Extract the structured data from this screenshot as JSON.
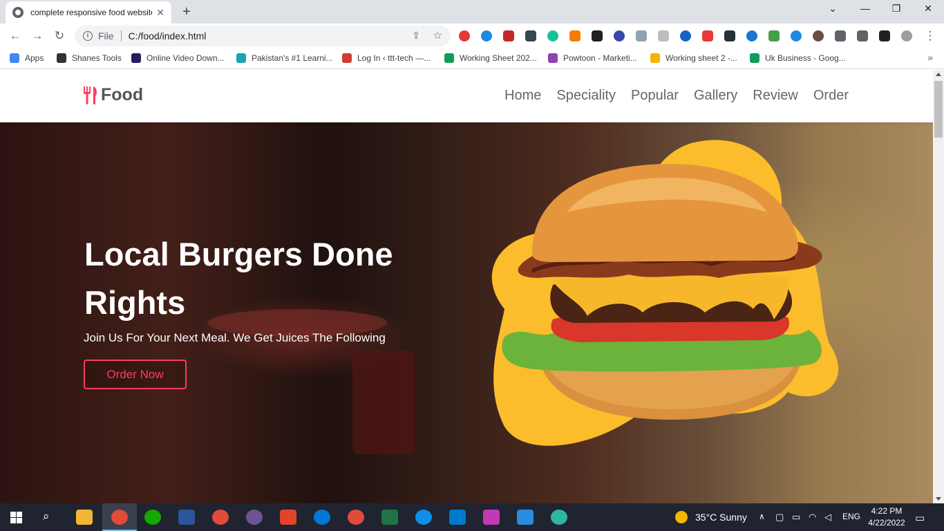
{
  "browser": {
    "tab_title": "complete responsive food website",
    "tab_close": "✕",
    "new_tab": "+",
    "url_scheme": "File",
    "url": "C:/food/index.html",
    "window_controls": {
      "minimize": "—",
      "restore": "❐",
      "close": "✕",
      "tab_search": "⌄"
    },
    "bookmarks": [
      {
        "label": "Apps",
        "color": "#4285f4"
      },
      {
        "label": "Shanes Tools",
        "color": "#333333"
      },
      {
        "label": "Online Video Down...",
        "color": "#2a1a5e"
      },
      {
        "label": "Pakistan's #1 Learni...",
        "color": "#1aa3b5"
      },
      {
        "label": "Log In ‹ ttt-tech —...",
        "color": "#d23b2f"
      },
      {
        "label": "Working Sheet 202...",
        "color": "#0f9d58"
      },
      {
        "label": "Powtoon - Marketi...",
        "color": "#8e44ad"
      },
      {
        "label": "Working sheet 2 -...",
        "color": "#f4b400"
      },
      {
        "label": "Uk Business - Goog...",
        "color": "#0f9d58"
      }
    ],
    "bookmarks_more": "»"
  },
  "site": {
    "logo_text": "Food",
    "nav": [
      "Home",
      "Speciality",
      "Popular",
      "Gallery",
      "Review",
      "Order"
    ],
    "hero": {
      "title": "Local Burgers Done Rights",
      "subtitle": "Join Us For Your Next Meal. We Get Juices The Following",
      "cta": "Order Now"
    },
    "accent_color": "#ff3d5e"
  },
  "taskbar": {
    "weather": "35°C  Sunny",
    "language": "ENG",
    "time": "4:22 PM",
    "date": "4/22/2022"
  }
}
